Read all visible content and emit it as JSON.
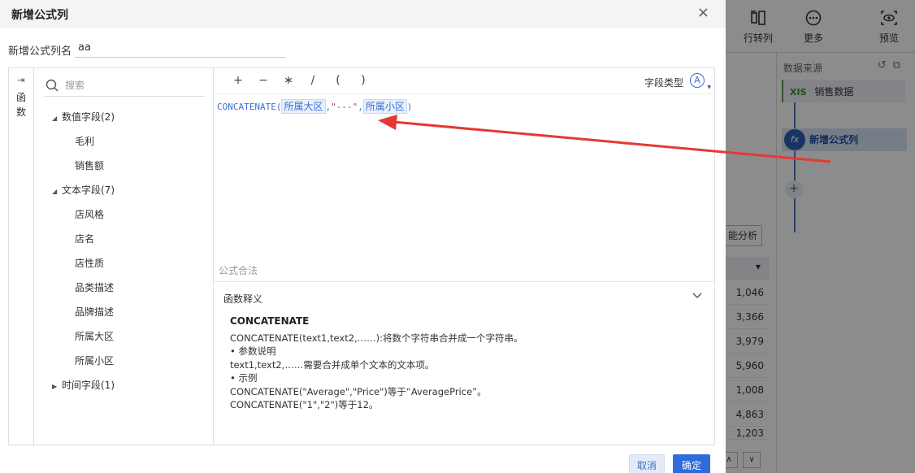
{
  "background": {
    "toolbar": [
      {
        "label": "行转列",
        "icon": "row-to-column-icon"
      },
      {
        "label": "更多",
        "icon": "more-icon"
      },
      {
        "label": "预览",
        "icon": "preview-icon"
      }
    ],
    "datasource_title": "数据来源",
    "datasource_item": {
      "badge": "XIS",
      "label": "销售数据"
    },
    "flow_node": {
      "icon_text": "fx",
      "label": "新增公式列"
    },
    "add_label": "+",
    "smart_button": "能分析",
    "column_values": [
      "1,046",
      "3,366",
      "3,979",
      "5,960",
      "1,008",
      "4,863",
      "1,203"
    ]
  },
  "dialog": {
    "title": "新增公式列",
    "close": "×",
    "name_label": "新增公式列名",
    "name_value": "aa",
    "fn_tab_label": "函数",
    "search_placeholder": "搜索",
    "tree": [
      {
        "label": "数值字段(2)",
        "expanded": true,
        "children": [
          "毛利",
          "销售额"
        ]
      },
      {
        "label": "文本字段(7)",
        "expanded": true,
        "children": [
          "店风格",
          "店名",
          "店性质",
          "品类描述",
          "品牌描述",
          "所属大区",
          "所属小区"
        ]
      },
      {
        "label": "时间字段(1)",
        "expanded": false,
        "children": []
      }
    ],
    "operators": [
      "+",
      "−",
      "∗",
      "/",
      "(",
      ")"
    ],
    "field_type_label": "字段类型",
    "field_type_icon": "Ⓐ",
    "formula": {
      "function": "CONCATENATE",
      "open": "(",
      "field1": "所属大区",
      "comma1": ",",
      "string": "\"---\"",
      "comma2": ",",
      "field2": "所属小区",
      "close": ")"
    },
    "legality_text": "公式合法",
    "explain": {
      "title": "函数释义",
      "function_name": "CONCATENATE",
      "lines": [
        "CONCATENATE(text1,text2,……):将数个字符串合并成一个字符串。",
        "• 参数说明",
        "text1,text2,……需要合并成单个文本的文本项。",
        "• 示例",
        "CONCATENATE(\"Average\",\"Price\")等于“AveragePrice”。",
        "CONCATENATE(\"1\",\"2\")等于12。"
      ]
    },
    "cancel_label": "取消",
    "ok_label": "确定"
  },
  "colors": {
    "accent": "#2f6bd9",
    "annotation_arrow": "#e53935",
    "formula_text": "#3a6fd8"
  }
}
